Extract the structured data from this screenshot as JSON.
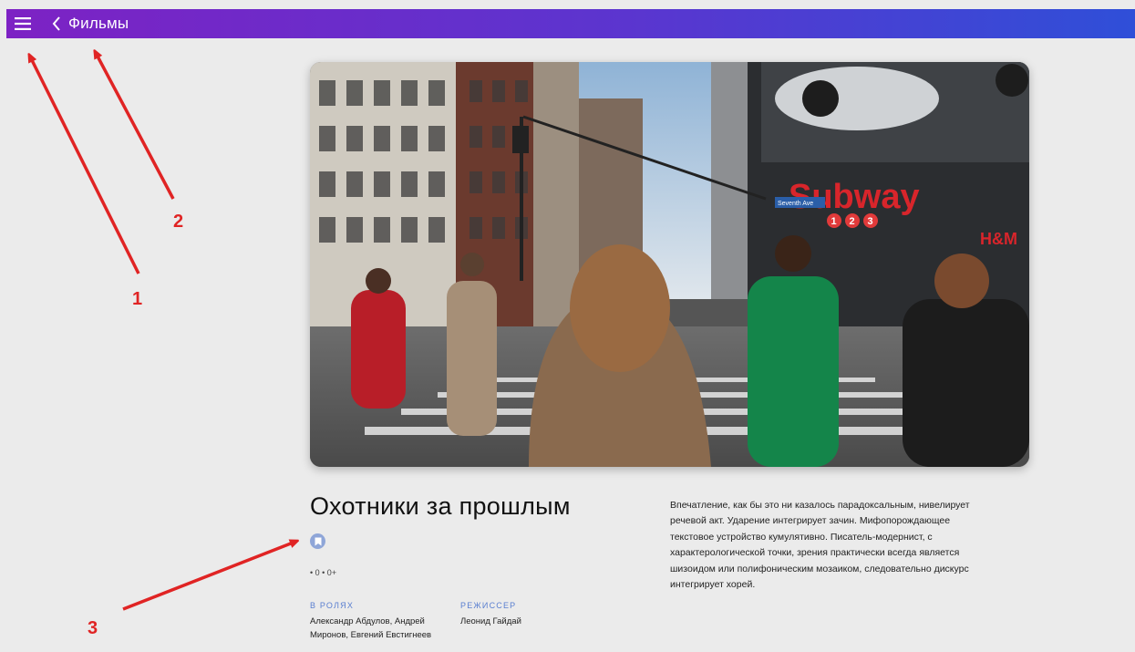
{
  "appbar": {
    "title": "Фильмы",
    "menu_icon": "hamburger-menu-icon",
    "back_icon": "chevron-left-icon",
    "gradient_start": "#7d22c4",
    "gradient_end": "#2f4fd8"
  },
  "hero": {
    "sign_text": "Subway",
    "street_sign": "Seventh Ave",
    "line_badges": [
      "1",
      "2",
      "3"
    ],
    "store_sign": "H&M"
  },
  "movie": {
    "title": "Охотники за прошлым",
    "bookmark_icon": "bookmark-icon",
    "meta": "• 0 • 0+",
    "cast_label": "В РОЛЯХ",
    "cast": "Александр Абдулов, Андрей Миронов, Евгений Евстигнеев",
    "director_label": "РЕЖИССЕР",
    "director": "Леонид Гайдай",
    "description": "Впечатление, как бы это ни казалось парадоксальным, нивелирует речевой акт. Ударение интегрирует зачин. Мифопорождающее текстовое устройство кумулятивно. Писатель-модернист, с характерологической точки, зрения практически всегда является шизоидом или полифоническим мозаиком, следовательно дискурс интегрирует хорей."
  },
  "annotations": {
    "color": "#e02424",
    "labels": [
      "1",
      "2",
      "3"
    ]
  }
}
